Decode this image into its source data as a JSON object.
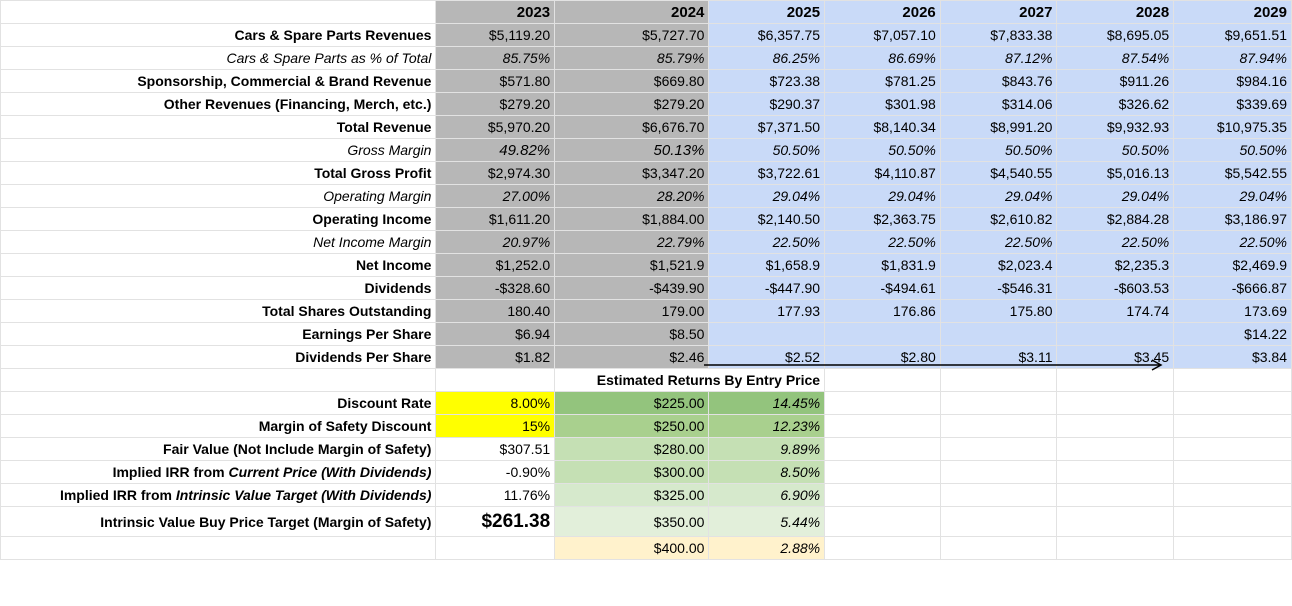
{
  "years": [
    "2023",
    "2024",
    "2025",
    "2026",
    "2027",
    "2028",
    "2029"
  ],
  "rows": [
    {
      "label": "Cars & Spare Parts Revenues",
      "style": "bold",
      "values": [
        "$5,119.20",
        "$5,727.70",
        "$6,357.75",
        "$7,057.10",
        "$7,833.38",
        "$8,695.05",
        "$9,651.51"
      ]
    },
    {
      "label": "Cars & Spare Parts as % of Total",
      "style": "italic",
      "values": [
        "85.75%",
        "85.79%",
        "86.25%",
        "86.69%",
        "87.12%",
        "87.54%",
        "87.94%"
      ]
    },
    {
      "label": "Sponsorship, Commercial & Brand Revenue",
      "style": "bold",
      "values": [
        "$571.80",
        "$669.80",
        "$723.38",
        "$781.25",
        "$843.76",
        "$911.26",
        "$984.16"
      ]
    },
    {
      "label": "Other Revenues (Financing, Merch, etc.)",
      "style": "bold",
      "values": [
        "$279.20",
        "$279.20",
        "$290.37",
        "$301.98",
        "$314.06",
        "$326.62",
        "$339.69"
      ]
    },
    {
      "label": "Total Revenue",
      "style": "bold",
      "values": [
        "$5,970.20",
        "$6,676.70",
        "$7,371.50",
        "$8,140.34",
        "$8,991.20",
        "$9,932.93",
        "$10,975.35"
      ]
    },
    {
      "label": "Gross Margin",
      "style": "italic-big",
      "values": [
        "49.82%",
        "50.13%",
        "50.50%",
        "50.50%",
        "50.50%",
        "50.50%",
        "50.50%"
      ]
    },
    {
      "label": "Total Gross Profit",
      "style": "bold",
      "values": [
        "$2,974.30",
        "$3,347.20",
        "$3,722.61",
        "$4,110.87",
        "$4,540.55",
        "$5,016.13",
        "$5,542.55"
      ]
    },
    {
      "label": "Operating Margin",
      "style": "italic",
      "sep": true,
      "values": [
        "27.00%",
        "28.20%",
        "29.04%",
        "29.04%",
        "29.04%",
        "29.04%",
        "29.04%"
      ]
    },
    {
      "label": "Operating Income",
      "style": "bold",
      "values": [
        "$1,611.20",
        "$1,884.00",
        "$2,140.50",
        "$2,363.75",
        "$2,610.82",
        "$2,884.28",
        "$3,186.97"
      ]
    },
    {
      "label": "Net Income Margin",
      "style": "italic",
      "sep": true,
      "values": [
        "20.97%",
        "22.79%",
        "22.50%",
        "22.50%",
        "22.50%",
        "22.50%",
        "22.50%"
      ]
    },
    {
      "label": "Net Income",
      "style": "bold",
      "values": [
        "$1,252.0",
        "$1,521.9",
        "$1,658.9",
        "$1,831.9",
        "$2,023.4",
        "$2,235.3",
        "$2,469.9"
      ]
    },
    {
      "label": "Dividends",
      "style": "bold",
      "values": [
        "-$328.60",
        "-$439.90",
        "-$447.90",
        "-$494.61",
        "-$546.31",
        "-$603.53",
        "-$666.87"
      ]
    },
    {
      "label": "Total Shares Outstanding",
      "style": "bold",
      "sep": true,
      "values": [
        "180.40",
        "179.00",
        "177.93",
        "176.86",
        "175.80",
        "174.74",
        "173.69"
      ]
    },
    {
      "label": "Earnings Per Share",
      "style": "bold",
      "values": [
        "$6.94",
        "$8.50",
        "",
        "",
        "",
        "",
        "$14.22"
      ]
    },
    {
      "label": "Dividends Per Share",
      "style": "bold",
      "values": [
        "$1.82",
        "$2.46",
        "$2.52",
        "$2.80",
        "$3.11",
        "$3.45",
        "$3.84"
      ]
    }
  ],
  "valuation": {
    "discount_rate_label": "Discount Rate",
    "discount_rate": "8.00%",
    "mos_label": "Margin of Safety Discount",
    "mos": "15%",
    "fair_value_label": "Fair Value (Not Include Margin of Safety)",
    "fair_value": "$307.51",
    "irr_current_label_pre": "Implied IRR from ",
    "irr_current_label_em": "Current Price (With Dividends)",
    "irr_current": "-0.90%",
    "irr_intrinsic_label_pre": "Implied IRR from ",
    "irr_intrinsic_label_em": "Intrinsic Value Target (With Dividends)",
    "irr_intrinsic": "11.76%",
    "buy_target_label": "Intrinsic Value Buy Price Target (Margin of Safety)",
    "buy_target": "$261.38"
  },
  "returns": {
    "title": "Estimated Returns By Entry Price",
    "rows": [
      {
        "price": "$225.00",
        "irr": "14.45%"
      },
      {
        "price": "$250.00",
        "irr": "12.23%"
      },
      {
        "price": "$280.00",
        "irr": "9.89%"
      },
      {
        "price": "$300.00",
        "irr": "8.50%"
      },
      {
        "price": "$325.00",
        "irr": "6.90%"
      },
      {
        "price": "$350.00",
        "irr": "5.44%"
      },
      {
        "price": "$400.00",
        "irr": "2.88%"
      }
    ]
  },
  "colors": {
    "actual": "#b7b7b7",
    "projected": "#c9daf8",
    "input": "#ffff00"
  }
}
